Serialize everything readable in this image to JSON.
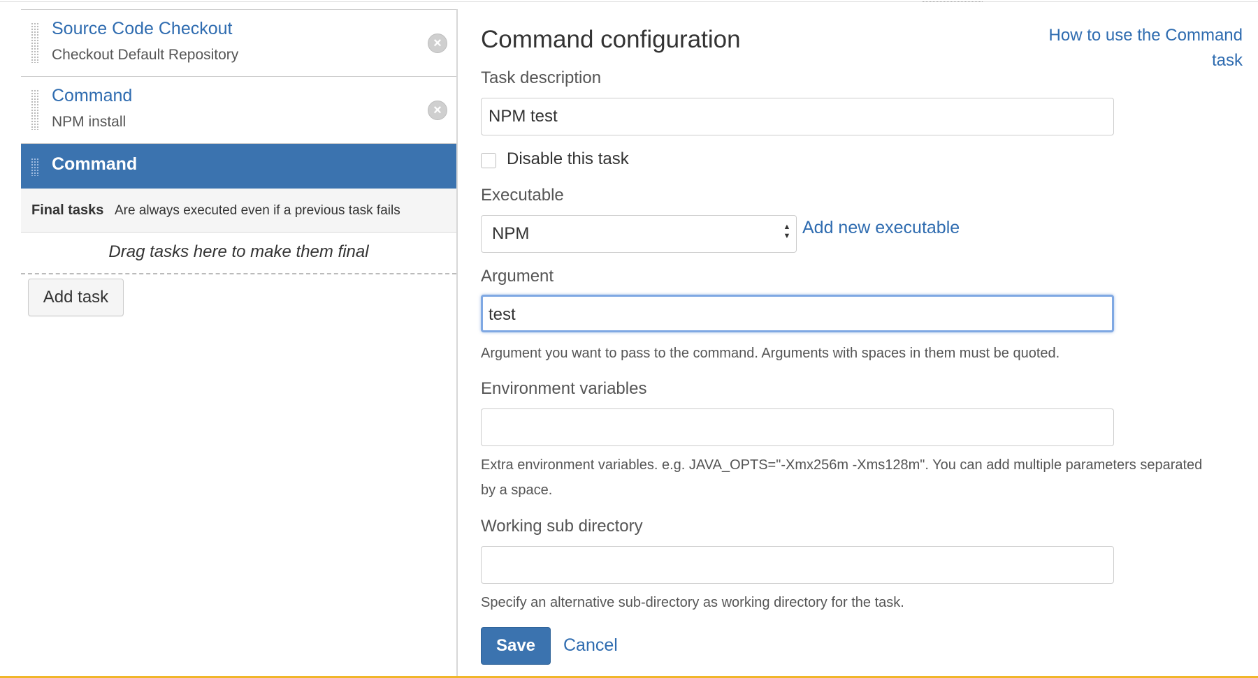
{
  "sidebar": {
    "tasks": [
      {
        "title": "Source Code Checkout",
        "subtitle": "Checkout Default Repository",
        "remove_icon": "x-circle-icon"
      },
      {
        "title": "Command",
        "subtitle": "NPM install",
        "remove_icon": "x-circle-icon"
      },
      {
        "title": "Command",
        "subtitle": "",
        "selected": true
      }
    ],
    "final_tasks": {
      "title": "Final tasks",
      "description": "Are always executed even if a previous task fails"
    },
    "drop_zone_text": "Drag tasks here to make them final",
    "add_task_label": "Add task"
  },
  "config": {
    "title": "Command configuration",
    "help_link": "How to use the Command task",
    "task_description": {
      "label": "Task description",
      "value": "NPM test"
    },
    "disable_task": {
      "label": "Disable this task",
      "checked": false
    },
    "executable": {
      "label": "Executable",
      "value": "NPM",
      "add_link": "Add new executable"
    },
    "argument": {
      "label": "Argument",
      "value": "test",
      "help": "Argument you want to pass to the command. Arguments with spaces in them must be quoted."
    },
    "environment": {
      "label": "Environment variables",
      "value": "",
      "help": "Extra environment variables. e.g. JAVA_OPTS=\"-Xmx256m -Xms128m\". You can add multiple parameters separated by a space."
    },
    "working_dir": {
      "label": "Working sub directory",
      "value": "",
      "help": "Specify an alternative sub-directory as working directory for the task."
    },
    "save_label": "Save",
    "cancel_label": "Cancel"
  },
  "colors": {
    "accent": "#3b73af",
    "link": "#2f6cb0",
    "bottom_bar": "#f0b62a"
  }
}
